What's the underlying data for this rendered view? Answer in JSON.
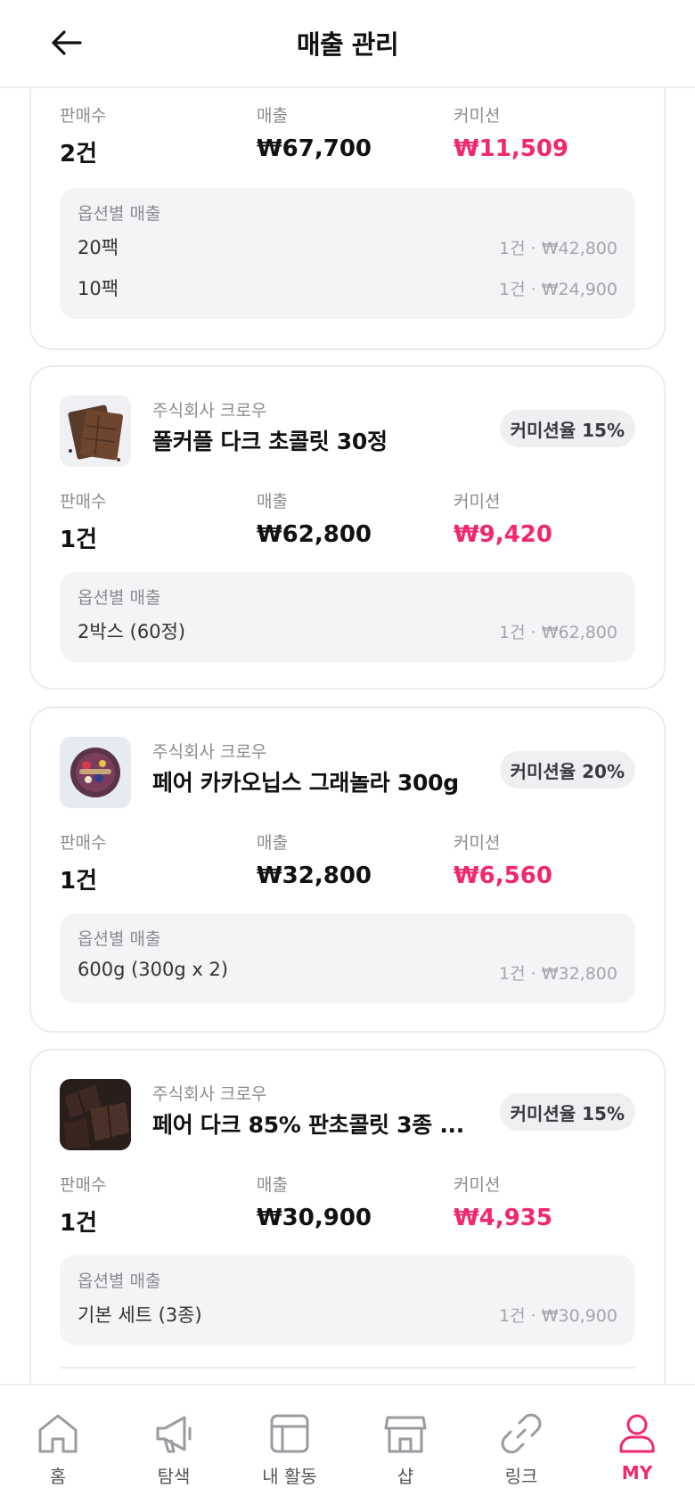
{
  "header": {
    "title": "매출 관리"
  },
  "labels": {
    "sales_count": "판매수",
    "revenue": "매출",
    "commission": "커미션",
    "option_sales": "옵션별 매출"
  },
  "cards": [
    {
      "stats": {
        "count": "2건",
        "revenue": "₩67,700",
        "commission": "₩11,509"
      },
      "options": [
        {
          "name": "20팩",
          "amount": "1건 · ₩42,800"
        },
        {
          "name": "10팩",
          "amount": "1건 · ₩24,900"
        }
      ]
    },
    {
      "seller": "주식회사 크로우",
      "name": "폴커플 다크 초콜릿 30정",
      "rate": "커미션율 15%",
      "thumb_icon": "chocolate-bar-thumbnail",
      "stats": {
        "count": "1건",
        "revenue": "₩62,800",
        "commission": "₩9,420"
      },
      "options": [
        {
          "name": "2박스 (60정)",
          "amount": "1건 · ₩62,800"
        }
      ]
    },
    {
      "seller": "주식회사 크로우",
      "name": "페어 카카오닙스 그래놀라 300g",
      "rate": "커미션율 20%",
      "thumb_icon": "granola-bowl-thumbnail",
      "stats": {
        "count": "1건",
        "revenue": "₩32,800",
        "commission": "₩6,560"
      },
      "options": [
        {
          "name": "600g (300g x 2)",
          "amount": "1건 · ₩32,800"
        }
      ]
    },
    {
      "seller": "주식회사 크로우",
      "name": "페어 다크 85% 판초콜릿 3종 ...",
      "rate": "커미션율 15%",
      "thumb_icon": "dark-chocolate-pieces-thumbnail",
      "stats": {
        "count": "1건",
        "revenue": "₩30,900",
        "commission": "₩4,935"
      },
      "options": [
        {
          "name": "기본 세트 (3종)",
          "amount": "1건 · ₩30,900"
        }
      ]
    }
  ],
  "tabbar": [
    {
      "label": "홈",
      "icon": "home-icon"
    },
    {
      "label": "탐색",
      "icon": "megaphone-icon"
    },
    {
      "label": "내 활동",
      "icon": "layout-icon"
    },
    {
      "label": "샵",
      "icon": "store-icon"
    },
    {
      "label": "링크",
      "icon": "link-icon"
    },
    {
      "label": "MY",
      "icon": "person-icon",
      "active": true
    }
  ],
  "colors": {
    "accent": "#f2276f",
    "muted": "#8c8c90",
    "option_bg": "#f4f4f6"
  }
}
